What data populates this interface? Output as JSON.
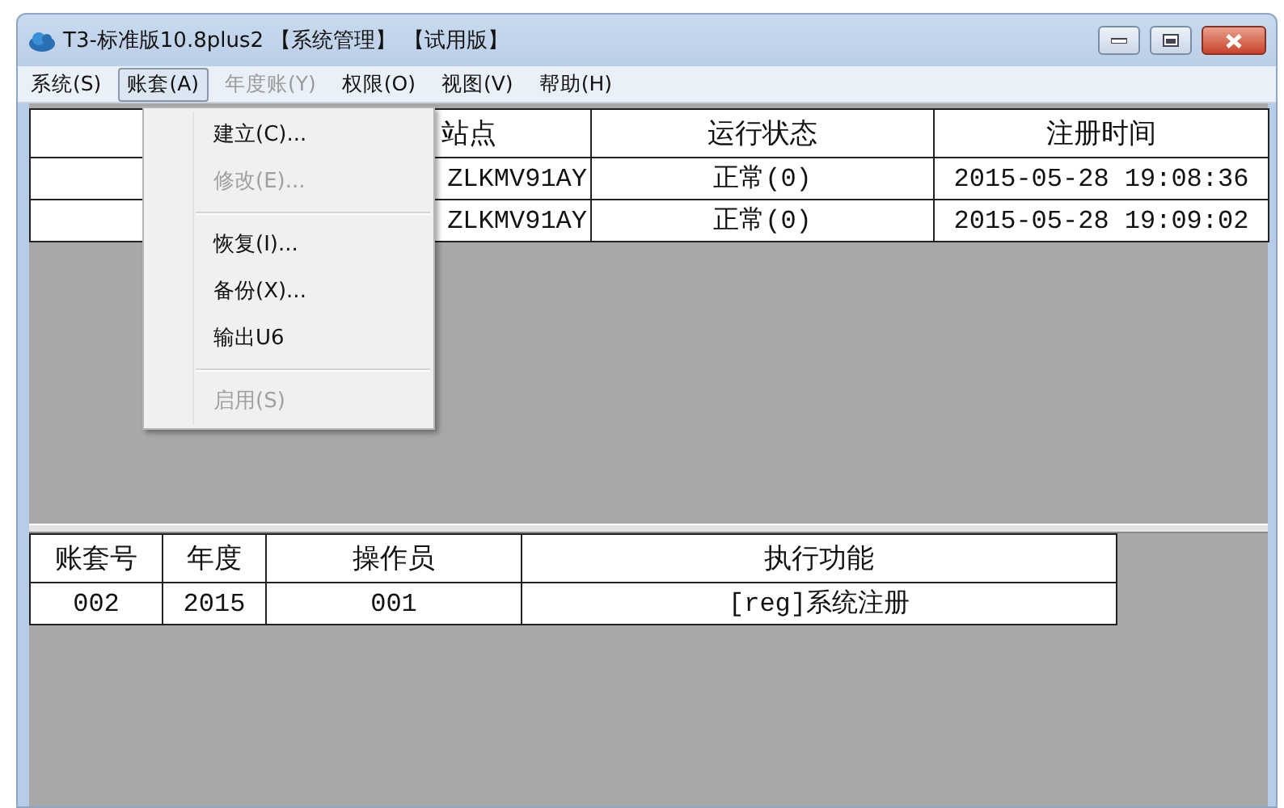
{
  "window": {
    "title": "T3-标准版10.8plus2 【系统管理】 【试用版】"
  },
  "menubar": [
    {
      "label": "系统(S)",
      "selected": false,
      "disabled": false
    },
    {
      "label": "账套(A)",
      "selected": true,
      "disabled": false
    },
    {
      "label": "年度账(Y)",
      "selected": false,
      "disabled": true
    },
    {
      "label": "权限(O)",
      "selected": false,
      "disabled": false
    },
    {
      "label": "视图(V)",
      "selected": false,
      "disabled": false
    },
    {
      "label": "帮助(H)",
      "selected": false,
      "disabled": false
    }
  ],
  "dropdown": [
    {
      "kind": "item",
      "label": "建立(C)...",
      "disabled": false
    },
    {
      "kind": "item",
      "label": "修改(E)...",
      "disabled": true
    },
    {
      "kind": "separator"
    },
    {
      "kind": "item",
      "label": "恢复(I)...",
      "disabled": false
    },
    {
      "kind": "item",
      "label": "备份(X)...",
      "disabled": false
    },
    {
      "kind": "item",
      "label": "输出U6",
      "disabled": false
    },
    {
      "kind": "separator"
    },
    {
      "kind": "item",
      "label": "启用(S)",
      "disabled": true
    }
  ],
  "sessions_table": {
    "columns": [
      "站点",
      "运行状态",
      "注册时间"
    ],
    "rows": [
      [
        "ZLKMV91AY",
        "正常(0)",
        "2015-05-28 19:08:36"
      ],
      [
        "ZLKMV91AY",
        "正常(0)",
        "2015-05-28 19:09:02"
      ]
    ]
  },
  "log_table": {
    "columns": [
      "账套号",
      "年度",
      "操作员",
      "执行功能"
    ],
    "rows": [
      [
        "002",
        "2015",
        "001",
        "[reg]系统注册"
      ]
    ]
  }
}
